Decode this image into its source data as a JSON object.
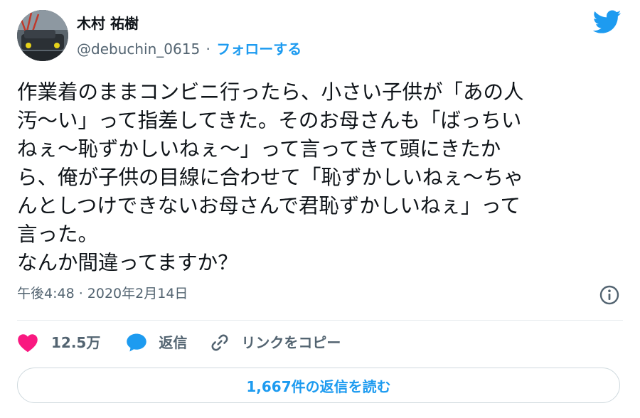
{
  "author": {
    "display_name": "木村 祐樹",
    "handle": "@debuchin_0615",
    "separator": "·",
    "follow_label": "フォローする"
  },
  "tweet": {
    "text": "作業着のままコンビニ行ったら、小さい子供が「あの人\n汚〜い」って指差してきた。そのお母さんも「ばっちい\nねぇ〜恥ずかしいねぇ〜」って言ってきて頭にきたか\nら、俺が子供の目線に合わせて「恥ずかしいねぇ〜ちゃ\nんとしつけできないお母さんで君恥ずかしいねぇ」って\n言った。\nなんか間違ってますか？",
    "timestamp": "午後4:48 · 2020年2月14日"
  },
  "actions": {
    "like_count": "12.5万",
    "reply_label": "返信",
    "copy_link_label": "リンクをコピー"
  },
  "read_replies_label": "1,667件の返信を読む",
  "icons": {
    "logo": "twitter-bird-icon",
    "info": "info-icon",
    "like": "heart-icon",
    "reply": "speech-bubble-icon",
    "copy_link": "link-icon"
  },
  "colors": {
    "accent": "#1d9bf0",
    "like": "#f91880",
    "text": "#0f1419",
    "muted": "#536471",
    "border": "#cfd9de"
  }
}
